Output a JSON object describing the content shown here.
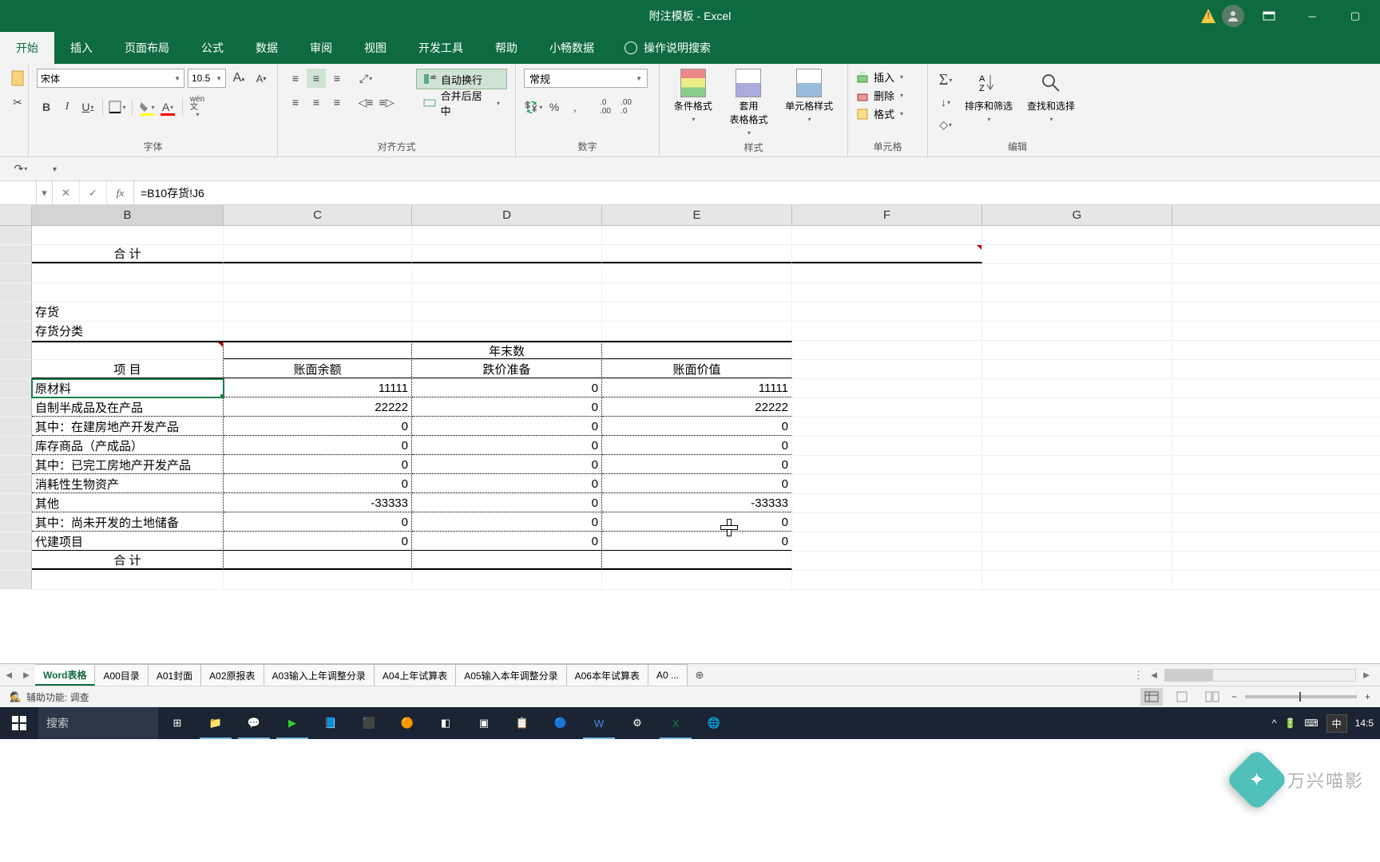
{
  "window": {
    "title": "附注模板 - Excel"
  },
  "tabs": {
    "active": "开始",
    "items": [
      "开始",
      "插入",
      "页面布局",
      "公式",
      "数据",
      "审阅",
      "视图",
      "开发工具",
      "帮助",
      "小畅数据"
    ],
    "tell_me": "操作说明搜索"
  },
  "ribbon": {
    "font": {
      "name": "宋体",
      "size": "10.5",
      "group": "字体"
    },
    "align": {
      "wrap": "自动换行",
      "merge": "合并后居中",
      "group": "对齐方式"
    },
    "number": {
      "format": "常规",
      "group": "数字"
    },
    "styles": {
      "cond": "条件格式",
      "table": "套用\n表格格式",
      "cell": "单元格样式",
      "group": "样式"
    },
    "cells": {
      "insert": "插入",
      "delete": "删除",
      "format": "格式",
      "group": "单元格"
    },
    "editing": {
      "sort": "排序和筛选",
      "find": "查找和选择",
      "group": "编辑"
    }
  },
  "formula_bar": {
    "formula": "=B10存货!J6"
  },
  "col_headers": [
    "B",
    "C",
    "D",
    "E",
    "F",
    "G"
  ],
  "grid": {
    "heji_top": "合 计",
    "section": "存货",
    "subsection": "存货分类",
    "project": "项    目",
    "yearend": "年末数",
    "h1": "账面余额",
    "h2": "跌价准备",
    "h3": "账面价值",
    "rows": [
      {
        "b": "原材料",
        "c": "11111",
        "d": "0",
        "e": "11111"
      },
      {
        "b": "自制半成品及在产品",
        "c": "22222",
        "d": "0",
        "e": "22222"
      },
      {
        "b": "其中：在建房地产开发产品",
        "c": "0",
        "d": "0",
        "e": "0"
      },
      {
        "b": "库存商品（产成品）",
        "c": "0",
        "d": "0",
        "e": "0"
      },
      {
        "b": "其中：已完工房地产开发产品",
        "c": "0",
        "d": "0",
        "e": "0"
      },
      {
        "b": "消耗性生物资产",
        "c": "0",
        "d": "0",
        "e": "0"
      },
      {
        "b": "其他",
        "c": "-33333",
        "d": "0",
        "e": "-33333"
      },
      {
        "b": "其中：尚未开发的土地储备",
        "c": "0",
        "d": "0",
        "e": "0"
      },
      {
        "b": "代建项目",
        "c": "0",
        "d": "0",
        "e": "0"
      }
    ],
    "heji_bot": "合    计"
  },
  "sheets": {
    "active": "Word表格",
    "items": [
      "Word表格",
      "A00目录",
      "A01封面",
      "A02原报表",
      "A03输入上年调整分录",
      "A04上年试算表",
      "A05输入本年调整分录",
      "A06本年试算表",
      "A0 ..."
    ]
  },
  "status": {
    "accessibility": "辅助功能: 调查"
  },
  "taskbar": {
    "search": "搜索",
    "ime": "中",
    "time": "14:5"
  },
  "watermark": "万兴喵影"
}
